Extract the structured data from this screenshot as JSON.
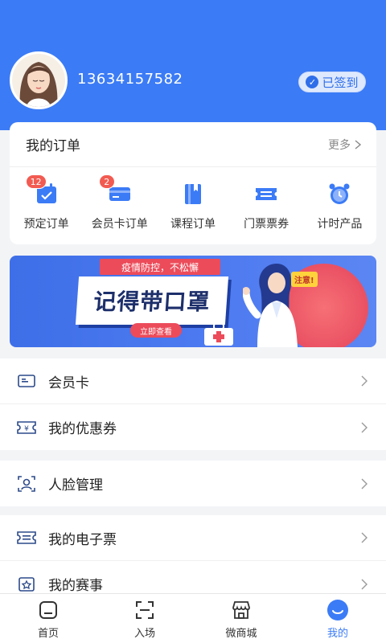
{
  "profile": {
    "phone": "13634157582",
    "signin_label": "已签到"
  },
  "orders": {
    "title": "我的订单",
    "more_label": "更多",
    "items": [
      {
        "label": "预定订单",
        "badge": "12"
      },
      {
        "label": "会员卡订单",
        "badge": "2"
      },
      {
        "label": "课程订单"
      },
      {
        "label": "门票票券"
      },
      {
        "label": "计时产品"
      }
    ]
  },
  "banner": {
    "slogan": "疫情防控，不松懈",
    "headline": "记得带口罩",
    "cta": "立即查看",
    "tag": "注意!"
  },
  "menu": {
    "group1": [
      {
        "label": "会员卡",
        "icon": "member-card-icon"
      },
      {
        "label": "我的优惠券",
        "icon": "coupon-icon"
      }
    ],
    "group2": [
      {
        "label": "人脸管理",
        "icon": "face-icon"
      }
    ],
    "group3": [
      {
        "label": "我的电子票",
        "icon": "e-ticket-icon"
      },
      {
        "label": "我的赛事",
        "icon": "event-icon"
      }
    ]
  },
  "tabbar": [
    {
      "label": "首页",
      "icon": "home-icon"
    },
    {
      "label": "入场",
      "icon": "scan-icon"
    },
    {
      "label": "微商城",
      "icon": "shop-icon"
    },
    {
      "label": "我的",
      "icon": "profile-icon",
      "active": true
    }
  ],
  "colors": {
    "brand": "#3b7bf6",
    "badge": "#f25b52",
    "banner_accent": "#ec4b5a"
  }
}
